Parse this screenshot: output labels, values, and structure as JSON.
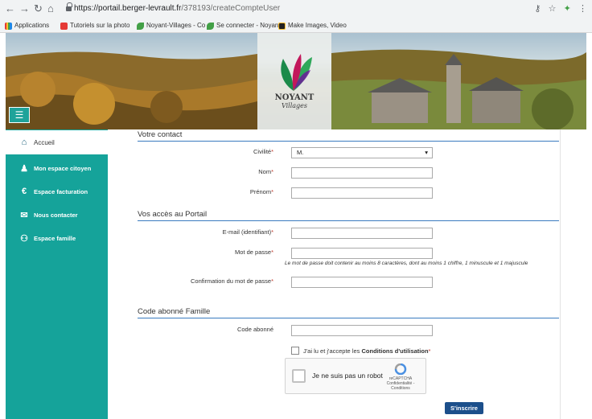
{
  "browser": {
    "url_host": "https://portail.berger-levrault.fr",
    "url_path": "/378193/createCompteUser",
    "bookmarks": [
      {
        "label": "Applications",
        "color": "#4285f4"
      },
      {
        "label": "Tutoriels sur la photo",
        "color": "#e53935"
      },
      {
        "label": "Noyant-Villages - Co",
        "color": "#43a047"
      },
      {
        "label": "Se connecter - Noyan",
        "color": "#43a047"
      },
      {
        "label": "Make Images, Video",
        "color": "#222222"
      }
    ]
  },
  "banner": {
    "logo_title": "NOYANT",
    "logo_subtitle": "Villages",
    "menu_icon": "hamburger-icon"
  },
  "sidebar": {
    "items": [
      {
        "label": "Accueil",
        "icon": "home-icon",
        "glyph": "🏠",
        "active": true
      },
      {
        "label": "Mon espace citoyen",
        "icon": "user-icon",
        "glyph": "👤",
        "active": false
      },
      {
        "label": "Espace facturation",
        "icon": "euro-icon",
        "glyph": "€",
        "active": false
      },
      {
        "label": "Nous contacter",
        "icon": "envelope-icon",
        "glyph": "✉",
        "active": false
      },
      {
        "label": "Espace famille",
        "icon": "family-icon",
        "glyph": "👪",
        "active": false
      }
    ]
  },
  "form": {
    "contact_title": "Votre contact",
    "civilite_label": "Civilité",
    "civilite_value": "M.",
    "nom_label": "Nom",
    "prenom_label": "Prénom",
    "acces_title": "Vos accès au Portail",
    "email_label": "E-mail (identifiant)",
    "password_label": "Mot de passe",
    "password_hint": "Le mot de passe doit contenir au moins 8 caractères, dont au moins 1 chiffre, 1 minuscule et 1 majuscule",
    "confirm_label": "Confirmation du mot de passe",
    "famille_title": "Code abonné Famille",
    "code_label": "Code abonné",
    "cgu_prefix": "J'ai lu et j'accepte les",
    "cgu_link": "Conditions d'utilisation",
    "required_mark": "*",
    "captcha_text": "Je ne suis pas un robot",
    "captcha_brand": "reCAPTCHA",
    "captcha_links": "Confidentialité - Conditions",
    "submit_label": "S'inscrire"
  },
  "colors": {
    "sidebar": "#15a39a",
    "submit": "#1c4f8b",
    "section_rule": "#3a7bbf"
  }
}
